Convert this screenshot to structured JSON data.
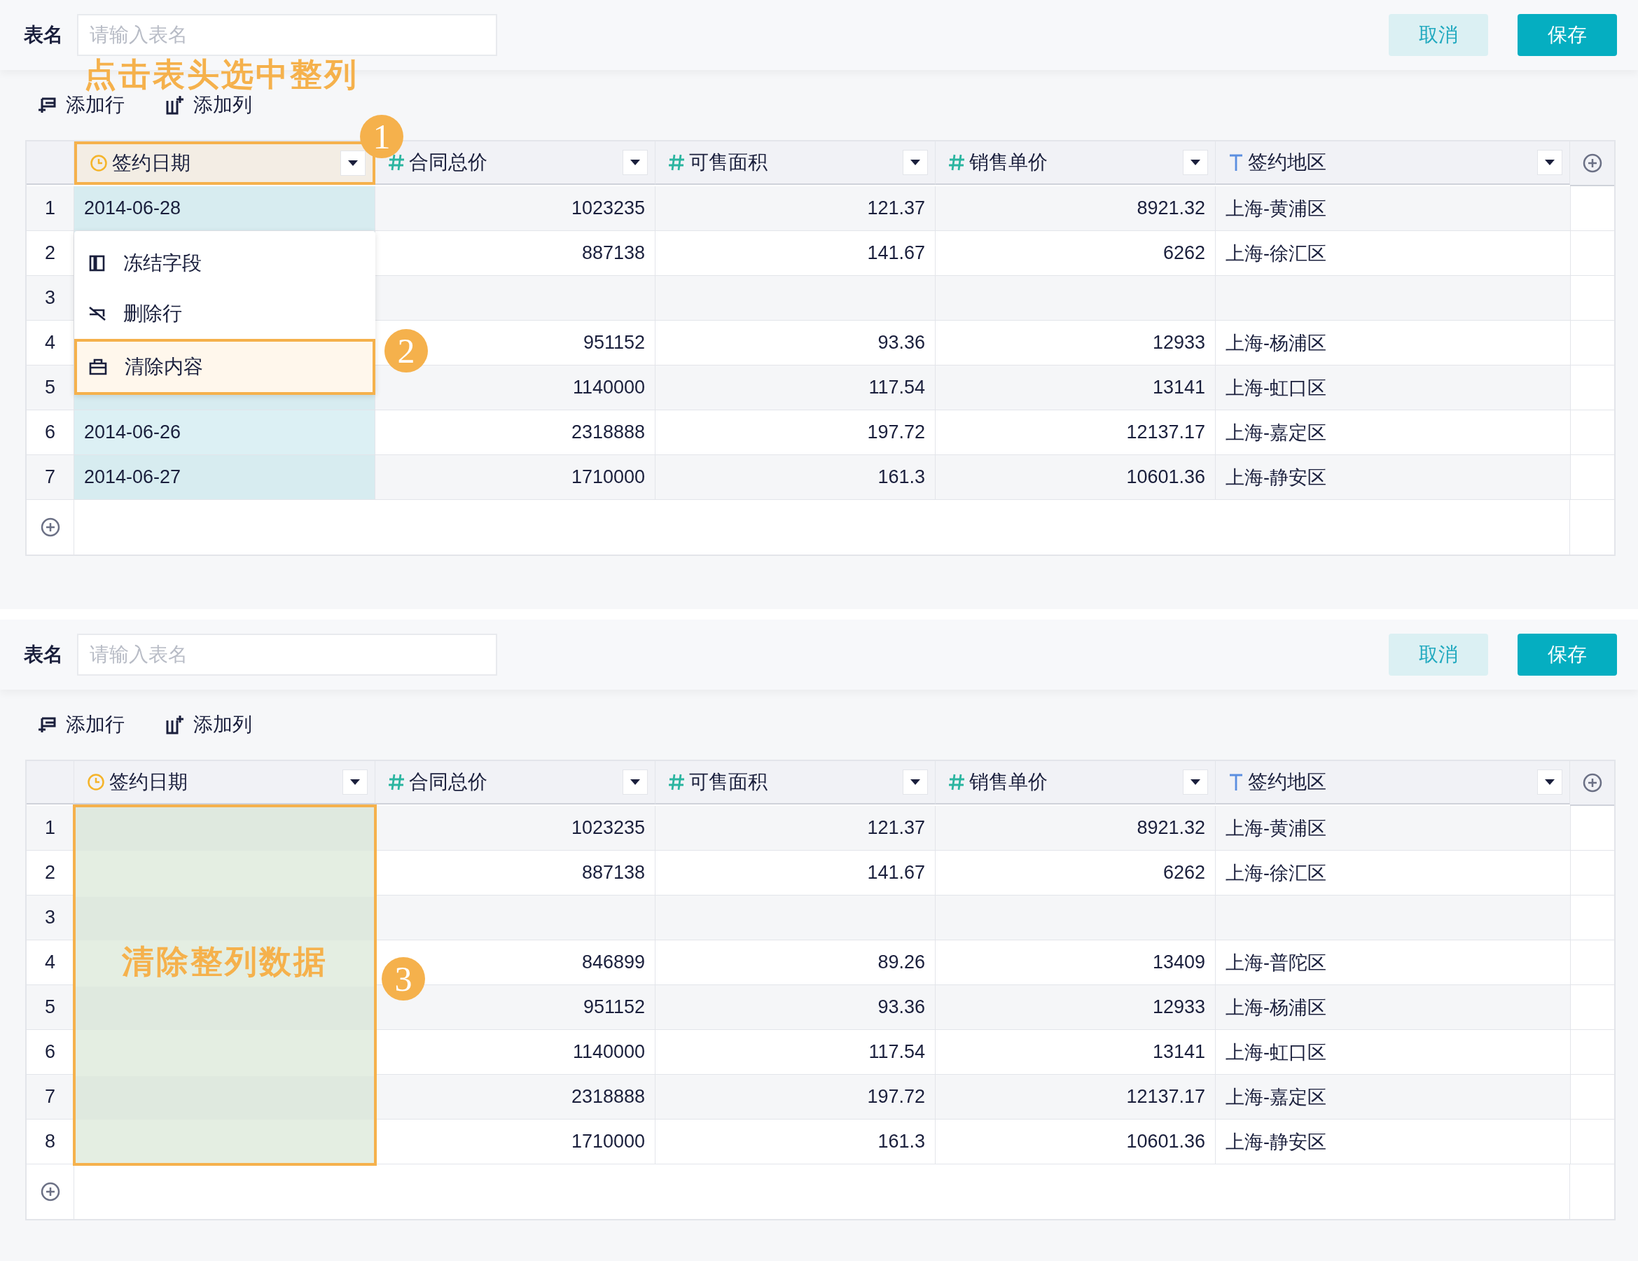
{
  "panels": [
    {
      "name_label": "表名",
      "name_placeholder": "请输入表名",
      "buttons": [
        {
          "label": "取消",
          "kind": "secondary"
        },
        {
          "label": "保存",
          "kind": "primary"
        }
      ],
      "hint": "点击表头选中整列",
      "toolbar": [
        {
          "label": "添加行",
          "kind": "add-row"
        },
        {
          "label": "添加列",
          "kind": "add-column"
        }
      ],
      "columns": [
        {
          "label": "签约日期",
          "kind": "date",
          "selected": true,
          "badge": "1"
        },
        {
          "label": "合同总价",
          "kind": "number",
          "selected": false
        },
        {
          "label": "可售面积",
          "kind": "number",
          "selected": false
        },
        {
          "label": "销售单价",
          "kind": "number",
          "selected": false
        },
        {
          "label": "签约地区",
          "kind": "text",
          "selected": false
        }
      ],
      "rows": [
        {
          "index": "1",
          "cells": [
            "2014-06-28",
            "1023235",
            "121.37",
            "8921.32",
            "上海-黄浦区"
          ]
        },
        {
          "index": "2",
          "cells": [
            null,
            "887138",
            "141.67",
            "6262",
            "上海-徐汇区"
          ]
        },
        {
          "index": "3",
          "cells": [
            null,
            null,
            null,
            null,
            null
          ]
        },
        {
          "index": "4",
          "cells": [
            null,
            "951152",
            "93.36",
            "12933",
            "上海-杨浦区"
          ]
        },
        {
          "index": "5",
          "cells": [
            null,
            "1140000",
            "117.54",
            "13141",
            "上海-虹口区"
          ]
        },
        {
          "index": "6",
          "cells": [
            "2014-06-26",
            "2318888",
            "197.72",
            "12137.17",
            "上海-嘉定区"
          ]
        },
        {
          "index": "7",
          "cells": [
            "2014-06-27",
            "1710000",
            "161.3",
            "10601.36",
            "上海-静安区"
          ]
        }
      ],
      "menu": {
        "items": [
          {
            "label": "冻结字段",
            "kind": "freeze",
            "selected": false
          },
          {
            "label": "删除行",
            "kind": "delete-row",
            "selected": false
          },
          {
            "label": "清除内容",
            "kind": "clear",
            "selected": true,
            "badge": "2"
          }
        ]
      }
    },
    {
      "name_label": "表名",
      "name_placeholder": "请输入表名",
      "buttons": [
        {
          "label": "取消",
          "kind": "secondary"
        },
        {
          "label": "保存",
          "kind": "primary"
        }
      ],
      "toolbar": [
        {
          "label": "添加行",
          "kind": "add-row"
        },
        {
          "label": "添加列",
          "kind": "add-column"
        }
      ],
      "columns": [
        {
          "label": "签约日期",
          "kind": "date",
          "selected": false
        },
        {
          "label": "合同总价",
          "kind": "number",
          "selected": false
        },
        {
          "label": "可售面积",
          "kind": "number",
          "selected": false
        },
        {
          "label": "销售单价",
          "kind": "number",
          "selected": false
        },
        {
          "label": "签约地区",
          "kind": "text",
          "selected": false
        }
      ],
      "rows": [
        {
          "index": "1",
          "cells": [
            null,
            "1023235",
            "121.37",
            "8921.32",
            "上海-黄浦区"
          ]
        },
        {
          "index": "2",
          "cells": [
            null,
            "887138",
            "141.67",
            "6262",
            "上海-徐汇区"
          ]
        },
        {
          "index": "3",
          "cells": [
            null,
            null,
            null,
            null,
            null
          ]
        },
        {
          "index": "4",
          "cells": [
            null,
            "846899",
            "89.26",
            "13409",
            "上海-普陀区"
          ]
        },
        {
          "index": "5",
          "cells": [
            null,
            "951152",
            "93.36",
            "12933",
            "上海-杨浦区"
          ]
        },
        {
          "index": "6",
          "cells": [
            null,
            "1140000",
            "117.54",
            "13141",
            "上海-虹口区"
          ]
        },
        {
          "index": "7",
          "cells": [
            null,
            "2318888",
            "197.72",
            "12137.17",
            "上海-嘉定区"
          ]
        },
        {
          "index": "8",
          "cells": [
            null,
            "1710000",
            "161.3",
            "10601.36",
            "上海-静安区"
          ]
        }
      ],
      "overlay": {
        "text": "清除整列数据",
        "badge": "3"
      }
    }
  ]
}
